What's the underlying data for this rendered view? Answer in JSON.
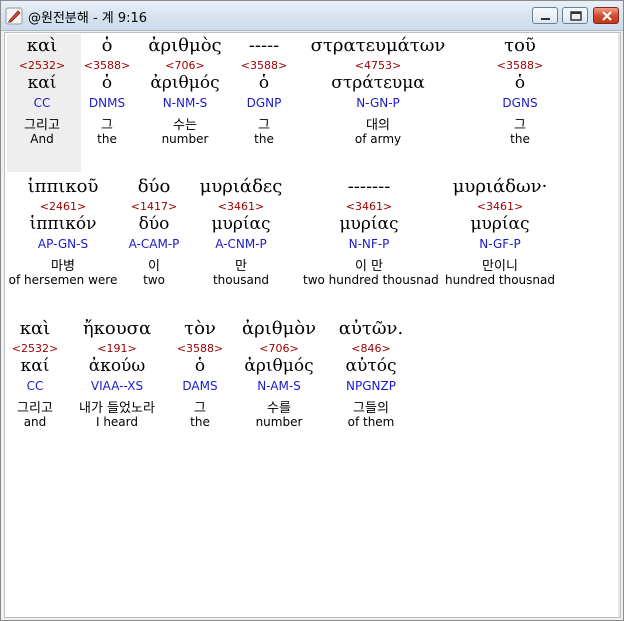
{
  "window": {
    "title": "@원전분해 - 계 9:16",
    "icon": "feather-pen-icon"
  },
  "colors": {
    "strongs": "#990000",
    "parsing": "#1a1acc",
    "text": "#000000",
    "highlight": "#eeeeee"
  },
  "rows": [
    {
      "words": [
        {
          "greek": "καὶ",
          "strongs": "<2532>",
          "lemma": "καί",
          "parse": "CC",
          "korean": "그리고",
          "english": "And"
        },
        {
          "greek": "ὁ",
          "strongs": "<3588>",
          "lemma": "ὁ",
          "parse": "DNMS",
          "korean": "그",
          "english": "the"
        },
        {
          "greek": "ἀριθμὸς",
          "strongs": "<706>",
          "lemma": "ἀριθμός",
          "parse": "N-NM-S",
          "korean": "수는",
          "english": "number"
        },
        {
          "greek": "-----",
          "strongs": "<3588>",
          "lemma": "ὁ",
          "parse": "DGNP",
          "korean": "그",
          "english": "the"
        },
        {
          "greek": "στρατευμάτων",
          "strongs": "<4753>",
          "lemma": "στράτευμα",
          "parse": "N-GN-P",
          "korean": "대의",
          "english": "of army"
        },
        {
          "greek": "τοῦ",
          "strongs": "<3588>",
          "lemma": "ὁ",
          "parse": "DGNS",
          "korean": "그",
          "english": "the"
        }
      ]
    },
    {
      "words": [
        {
          "greek": "ἱππικοῦ",
          "strongs": "<2461>",
          "lemma": "ἱππικόν",
          "parse": "AP-GN-S",
          "korean": "마병",
          "english": "of hersemen were"
        },
        {
          "greek": "δύο",
          "strongs": "<1417>",
          "lemma": "δύο",
          "parse": "A-CAM-P",
          "korean": "이",
          "english": "two"
        },
        {
          "greek": "μυριάδες",
          "strongs": "<3461>",
          "lemma": "μυρίας",
          "parse": "A-CNM-P",
          "korean": "만",
          "english": "thousand"
        },
        {
          "greek": "-------",
          "strongs": "<3461>",
          "lemma": "μυρίας",
          "parse": "N-NF-P",
          "korean": "이 만",
          "english": "two hundred thousnad"
        },
        {
          "greek": "μυριάδων·",
          "strongs": "<3461>",
          "lemma": "μυρίας",
          "parse": "N-GF-P",
          "korean": "만이니",
          "english": "hundred thousnad"
        }
      ]
    },
    {
      "words": [
        {
          "greek": "καὶ",
          "strongs": "<2532>",
          "lemma": "καί",
          "parse": "CC",
          "korean": "그리고",
          "english": "and"
        },
        {
          "greek": "ἤκουσα",
          "strongs": "<191>",
          "lemma": "ἀκούω",
          "parse": "VIAA--XS",
          "korean": "내가 들었노라",
          "english": "I heard"
        },
        {
          "greek": "τὸν",
          "strongs": "<3588>",
          "lemma": "ὁ",
          "parse": "DAMS",
          "korean": "그",
          "english": "the"
        },
        {
          "greek": "ἀριθμὸν",
          "strongs": "<706>",
          "lemma": "ἀριθμός",
          "parse": "N-AM-S",
          "korean": "수를",
          "english": "number"
        },
        {
          "greek": "αὐτῶν.",
          "strongs": "<846>",
          "lemma": "αὐτός",
          "parse": "NPGNZP",
          "korean": "그들의",
          "english": "of them"
        }
      ]
    }
  ]
}
